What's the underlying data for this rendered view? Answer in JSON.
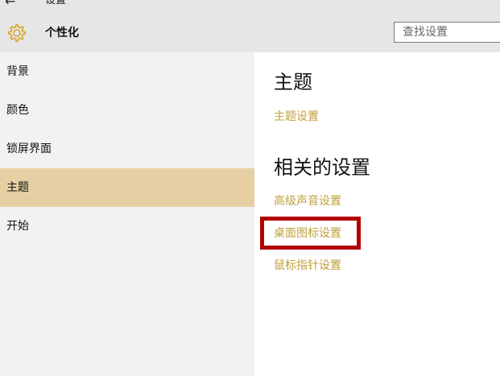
{
  "titlebar": {
    "back_label": "←",
    "title": "设置"
  },
  "header": {
    "icon": "gear-icon",
    "title": "个性化",
    "search_placeholder": "查找设置"
  },
  "sidebar": {
    "items": [
      {
        "label": "背景",
        "selected": false
      },
      {
        "label": "颜色",
        "selected": false
      },
      {
        "label": "锁屏界面",
        "selected": false
      },
      {
        "label": "主题",
        "selected": true
      },
      {
        "label": "开始",
        "selected": false
      }
    ]
  },
  "content": {
    "theme_section": {
      "title": "主题",
      "links": [
        "主题设置"
      ]
    },
    "related_section": {
      "title": "相关的设置",
      "links": [
        "高级声音设置",
        "桌面图标设置",
        "鼠标指针设置"
      ]
    }
  },
  "colors": {
    "header_bg": "#e6e6e6",
    "sidebar_bg": "#f2f2f2",
    "selected_bg": "#e6cfa3",
    "accent_link": "#c0a03a",
    "gear": "#d9a62c",
    "highlight": "#b20000"
  }
}
